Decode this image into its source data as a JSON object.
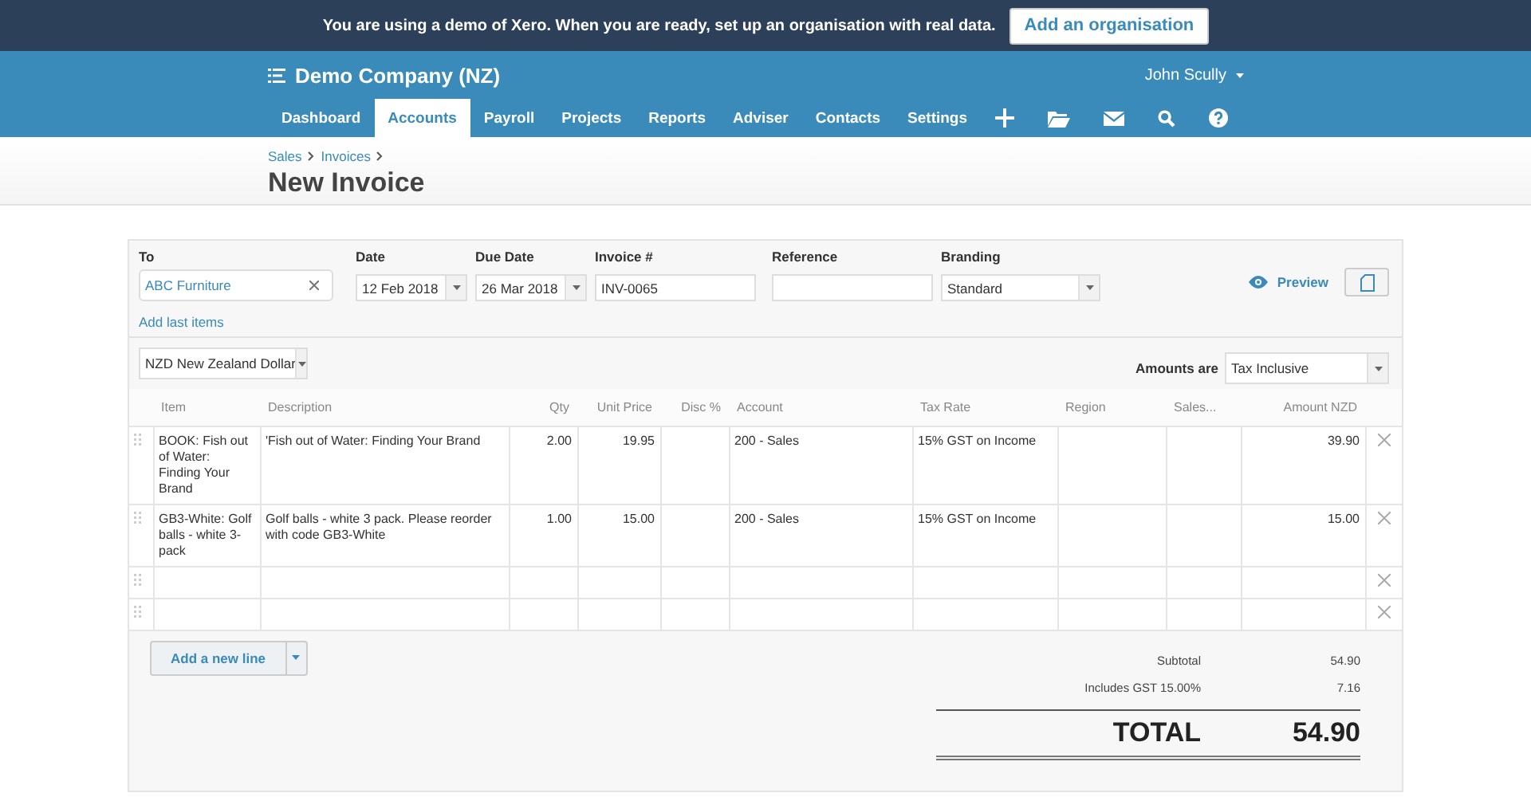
{
  "banner": {
    "text": "You are using a demo of Xero. When you are ready, set up an organisation with real data.",
    "button": "Add an organisation"
  },
  "header": {
    "company": "Demo Company (NZ)",
    "user": "John Scully"
  },
  "nav": [
    {
      "label": "Dashboard",
      "selected": false
    },
    {
      "label": "Accounts",
      "selected": true
    },
    {
      "label": "Payroll",
      "selected": false
    },
    {
      "label": "Projects",
      "selected": false
    },
    {
      "label": "Reports",
      "selected": false
    },
    {
      "label": "Adviser",
      "selected": false
    },
    {
      "label": "Contacts",
      "selected": false
    },
    {
      "label": "Settings",
      "selected": false
    }
  ],
  "breadcrumbs": [
    "Sales",
    "Invoices"
  ],
  "title": "New Invoice",
  "form": {
    "to": {
      "label": "To",
      "value": "ABC Furniture"
    },
    "date": {
      "label": "Date",
      "value": "12 Feb 2018"
    },
    "due_date": {
      "label": "Due Date",
      "value": "26 Mar 2018"
    },
    "invoice_number": {
      "label": "Invoice #",
      "value": "INV-0065"
    },
    "reference": {
      "label": "Reference"
    },
    "branding": {
      "label": "Branding",
      "value": "Standard"
    },
    "preview": "Preview",
    "add_last_items": "Add last items",
    "currency": "NZD New Zealand Dollar",
    "amounts_are": {
      "label": "Amounts are",
      "value": "Tax Inclusive"
    }
  },
  "table": {
    "columns": [
      "Item",
      "Description",
      "Qty",
      "Unit Price",
      "Disc %",
      "Account",
      "Tax Rate",
      "Region",
      "Sales...",
      "Amount NZD"
    ],
    "rows": [
      {
        "kind": "item",
        "cells": [
          "BOOK: Fish out of Water: Finding Your Brand",
          "'Fish out of Water: Finding Your Brand",
          "2.00",
          "19.95",
          null,
          "200 - Sales",
          "15% GST on Income",
          null,
          null,
          "39.90"
        ]
      },
      {
        "kind": "item",
        "cells": [
          "GB3-White: Golf balls - white 3-pack",
          "Golf balls - white 3 pack. Please reorder with code GB3-White",
          "1.00",
          "15.00",
          null,
          "200 - Sales",
          "15% GST on Income",
          null,
          null,
          "15.00"
        ]
      },
      {
        "kind": "blank"
      },
      {
        "kind": "blank"
      }
    ]
  },
  "add_line": "Add a new line",
  "totals": {
    "subtotal": {
      "label": "Subtotal",
      "value": "54.90"
    },
    "tax": {
      "label": "Includes GST 15.00%",
      "value": "7.16"
    },
    "total": {
      "label": "TOTAL",
      "value": "54.90"
    }
  }
}
